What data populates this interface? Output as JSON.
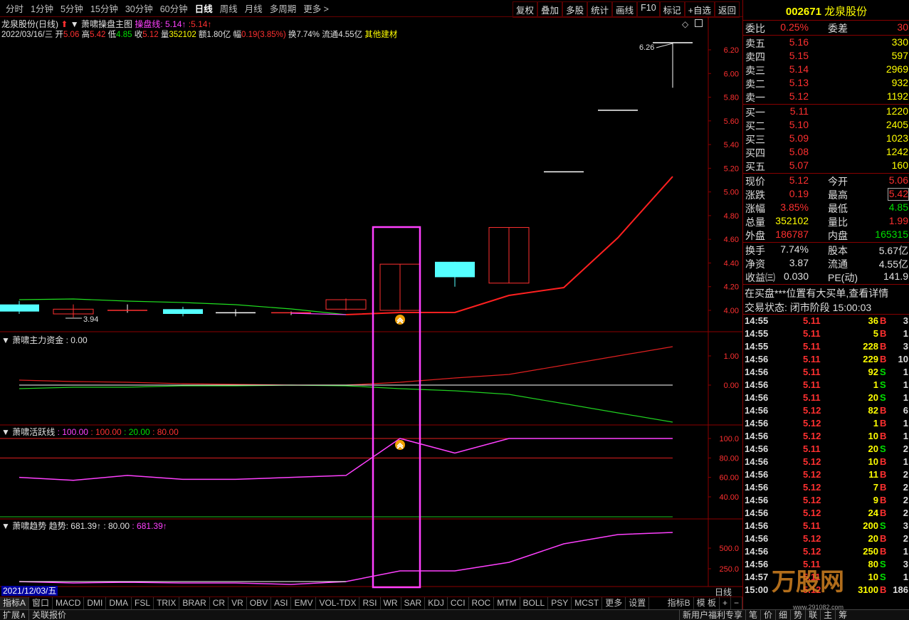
{
  "toolbar": {
    "periods": [
      "分时",
      "1分钟",
      "5分钟",
      "15分钟",
      "30分钟",
      "60分钟",
      "日线",
      "周线",
      "月线",
      "多周期",
      "更多 >"
    ],
    "active_period": "日线",
    "tools": [
      "复权",
      "叠加",
      "多股",
      "统计",
      "画线",
      "F10",
      "标记",
      "+自选",
      "返回"
    ]
  },
  "header": {
    "title": "龙泉股份(日线)",
    "formula": "萧啸操盘主图",
    "line_label": "操盘线:",
    "line_val1": "5.14↑",
    "line_val2": ":5.14↑"
  },
  "quote_line": {
    "date": "2022/03/16/三",
    "open_label": "开",
    "open": "5.06",
    "high_label": "高",
    "high": "5.42",
    "low_label": "低",
    "low": "4.85",
    "close_label": "收",
    "close": "5.12",
    "vol_label": "量",
    "vol": "352102",
    "amount_label": "额",
    "amount": "1.80亿",
    "chg_label": "幅",
    "chg": "0.19(3.85%)",
    "turnover_label": "换",
    "turnover": "7.74%",
    "float_label": "流通",
    "float": "4.55亿",
    "sector": "其他建材"
  },
  "main_axis": [
    "6.20",
    "6.00",
    "5.80",
    "5.60",
    "5.40",
    "5.20",
    "5.00",
    "4.80",
    "4.60",
    "4.40",
    "4.20",
    "4.00"
  ],
  "main_annotations": {
    "high_label": "6.26",
    "low_label": "3.94"
  },
  "panel1": {
    "name": "萧啸主力资金",
    "value": ": 0.00",
    "axis": [
      "1.00",
      "0.00"
    ]
  },
  "panel2": {
    "name": "萧啸活跃线",
    "v1": ": 100.00",
    "v2": ": 100.00",
    "v3": ": 20.00",
    "v4": ": 80.00",
    "axis": [
      "100.0",
      "80.00",
      "60.00",
      "40.00"
    ]
  },
  "panel3": {
    "name": "萧啸趋势",
    "trend_label": "趋势:",
    "v1": "681.39↑",
    "v2": ": 80.00",
    "v3": ": 681.39↑",
    "axis": [
      "500.0",
      "250.0"
    ]
  },
  "date_tag": "2021/12/03/五",
  "bottom_right_label": "日线",
  "indicator_tabs": [
    "指标A",
    "窗口",
    "MACD",
    "DMI",
    "DMA",
    "FSL",
    "TRIX",
    "BRAR",
    "CR",
    "VR",
    "OBV",
    "ASI",
    "EMV",
    "VOL-TDX",
    "RSI",
    "WR",
    "SAR",
    "KDJ",
    "CCI",
    "ROC",
    "MTM",
    "BOLL",
    "PSY",
    "MCST",
    "更多",
    "设置"
  ],
  "indicator_tabs_right": [
    "指标B",
    "模 板",
    "+",
    "−"
  ],
  "status_bar": {
    "left": [
      "扩展∧",
      "关联报价"
    ],
    "right": [
      "新用户福利专享",
      "笔",
      "价",
      "细",
      "势",
      "联",
      "主",
      "筹"
    ]
  },
  "stock": {
    "code": "002671",
    "name": "龙泉股份"
  },
  "order_book": {
    "weibi_label": "委比",
    "weibi": "0.25%",
    "weicha_label": "委差",
    "weicha": "30",
    "asks": [
      {
        "label": "卖五",
        "price": "5.16",
        "vol": "330"
      },
      {
        "label": "卖四",
        "price": "5.15",
        "vol": "597"
      },
      {
        "label": "卖三",
        "price": "5.14",
        "vol": "2969"
      },
      {
        "label": "卖二",
        "price": "5.13",
        "vol": "932"
      },
      {
        "label": "卖一",
        "price": "5.12",
        "vol": "1192"
      }
    ],
    "bids": [
      {
        "label": "买一",
        "price": "5.11",
        "vol": "1220"
      },
      {
        "label": "买二",
        "price": "5.10",
        "vol": "2405"
      },
      {
        "label": "买三",
        "price": "5.09",
        "vol": "1023"
      },
      {
        "label": "买四",
        "price": "5.08",
        "vol": "1242"
      },
      {
        "label": "买五",
        "price": "5.07",
        "vol": "160"
      }
    ]
  },
  "stats": [
    {
      "l1": "现价",
      "v1": "5.12",
      "c1": "red",
      "l2": "今开",
      "v2": "5.06",
      "c2": "red"
    },
    {
      "l1": "涨跌",
      "v1": "0.19",
      "c1": "red",
      "l2": "最高",
      "v2": "5.42",
      "c2": "red"
    },
    {
      "l1": "涨幅",
      "v1": "3.85%",
      "c1": "red",
      "l2": "最低",
      "v2": "4.85",
      "c2": "green"
    },
    {
      "l1": "总量",
      "v1": "352102",
      "c1": "yellow",
      "l2": "量比",
      "v2": "1.99",
      "c2": "red"
    },
    {
      "l1": "外盘",
      "v1": "186787",
      "c1": "red",
      "l2": "内盘",
      "v2": "165315",
      "c2": "green"
    }
  ],
  "stats2": [
    {
      "l1": "换手",
      "v1": "7.74%",
      "l2": "股本",
      "v2": "5.67亿"
    },
    {
      "l1": "净资",
      "v1": "3.87",
      "l2": "流通",
      "v2": "4.55亿"
    },
    {
      "l1": "收益㈢",
      "v1": "0.030",
      "l2": "PE(动)",
      "v2": "141.9"
    }
  ],
  "notice": "在买盘***位置有大买单,查看详情",
  "trade_state": "交易状态: 闭市阶段 15:00:03",
  "ticks": [
    {
      "t": "14:55",
      "p": "5.11",
      "pc": "red",
      "v": "36",
      "bs": "B",
      "n": "3"
    },
    {
      "t": "14:55",
      "p": "5.11",
      "pc": "red",
      "v": "5",
      "bs": "B",
      "n": "1"
    },
    {
      "t": "14:55",
      "p": "5.11",
      "pc": "red",
      "v": "228",
      "bs": "B",
      "n": "3"
    },
    {
      "t": "14:56",
      "p": "5.11",
      "pc": "red",
      "v": "229",
      "bs": "B",
      "n": "10"
    },
    {
      "t": "14:56",
      "p": "5.11",
      "pc": "red",
      "v": "92",
      "bs": "S",
      "n": "1"
    },
    {
      "t": "14:56",
      "p": "5.11",
      "pc": "red",
      "v": "1",
      "bs": "S",
      "n": "1"
    },
    {
      "t": "14:56",
      "p": "5.11",
      "pc": "red",
      "v": "20",
      "bs": "S",
      "n": "1"
    },
    {
      "t": "14:56",
      "p": "5.12",
      "pc": "red",
      "v": "82",
      "bs": "B",
      "n": "6"
    },
    {
      "t": "14:56",
      "p": "5.12",
      "pc": "red",
      "v": "1",
      "bs": "B",
      "n": "1"
    },
    {
      "t": "14:56",
      "p": "5.12",
      "pc": "red",
      "v": "10",
      "bs": "B",
      "n": "1"
    },
    {
      "t": "14:56",
      "p": "5.11",
      "pc": "red",
      "v": "20",
      "bs": "S",
      "n": "2"
    },
    {
      "t": "14:56",
      "p": "5.12",
      "pc": "red",
      "v": "10",
      "bs": "B",
      "n": "1"
    },
    {
      "t": "14:56",
      "p": "5.12",
      "pc": "red",
      "v": "11",
      "bs": "B",
      "n": "2"
    },
    {
      "t": "14:56",
      "p": "5.12",
      "pc": "red",
      "v": "7",
      "bs": "B",
      "n": "2"
    },
    {
      "t": "14:56",
      "p": "5.12",
      "pc": "red",
      "v": "9",
      "bs": "B",
      "n": "2"
    },
    {
      "t": "14:56",
      "p": "5.12",
      "pc": "red",
      "v": "24",
      "bs": "B",
      "n": "2"
    },
    {
      "t": "14:56",
      "p": "5.11",
      "pc": "red",
      "v": "200",
      "bs": "S",
      "n": "3"
    },
    {
      "t": "14:56",
      "p": "5.12",
      "pc": "red",
      "v": "20",
      "bs": "B",
      "n": "2"
    },
    {
      "t": "14:56",
      "p": "5.12",
      "pc": "red",
      "v": "250",
      "bs": "B",
      "n": "1"
    },
    {
      "t": "14:56",
      "p": "5.11",
      "pc": "red",
      "v": "80",
      "bs": "S",
      "n": "3"
    },
    {
      "t": "14:57",
      "p": "5.11",
      "pc": "red",
      "v": "10",
      "bs": "S",
      "n": "1"
    },
    {
      "t": "15:00",
      "p": "5.12",
      "pc": "red",
      "v": "3100",
      "bs": "B",
      "n": "186"
    }
  ],
  "watermark": {
    "brand": "万股网",
    "url": "www.291082.com"
  },
  "colors": {
    "up": "#ff3030",
    "down": "#54ffff",
    "grid": "#8b0000",
    "highlight": "#ff40ff"
  }
}
